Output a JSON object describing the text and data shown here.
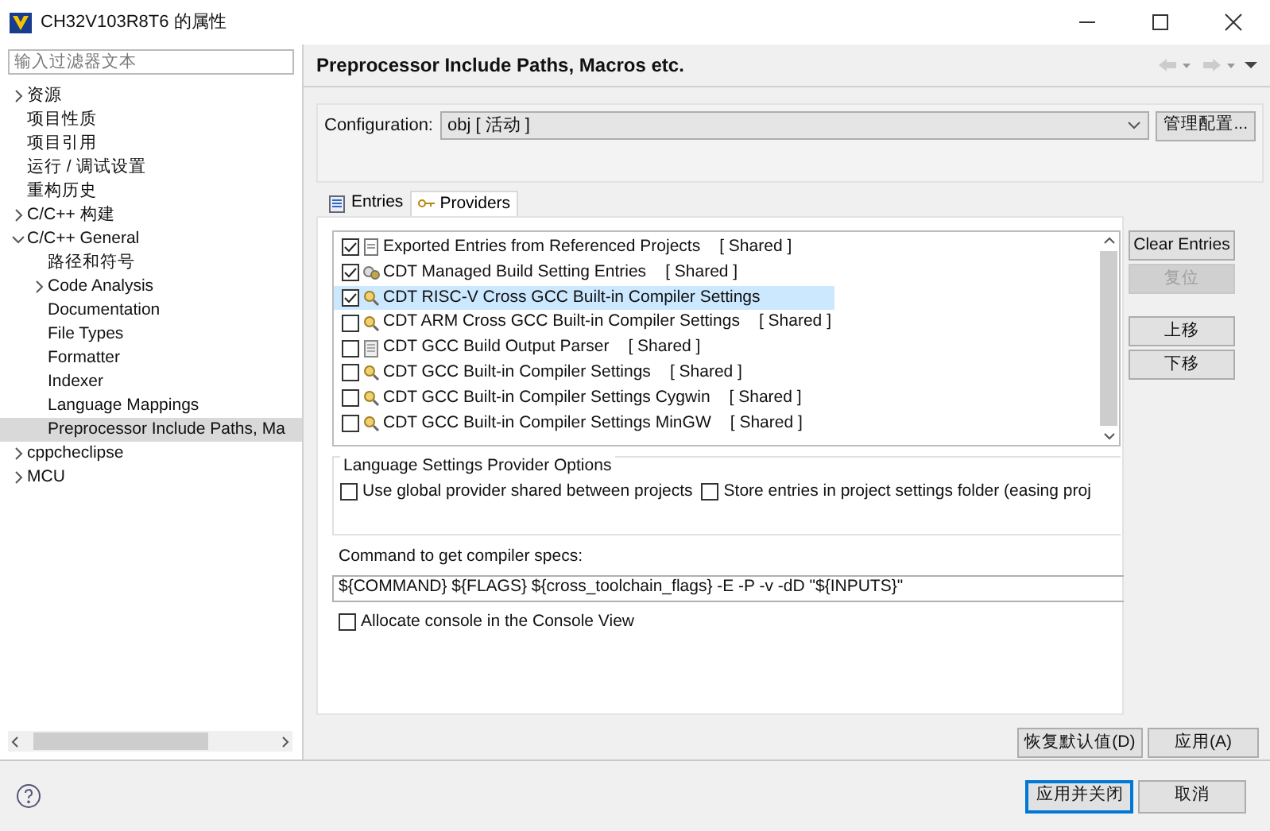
{
  "window": {
    "title": "CH32V103R8T6 的属性"
  },
  "filter": {
    "placeholder": "输入过滤器文本"
  },
  "tree": [
    {
      "label": "资源",
      "kind": "branch",
      "expanded": false,
      "selected": false
    },
    {
      "label": "项目性质",
      "kind": "leaf",
      "selected": false
    },
    {
      "label": "项目引用",
      "kind": "leaf",
      "selected": false
    },
    {
      "label": "运行 / 调试设置",
      "kind": "leaf",
      "selected": false
    },
    {
      "label": "重构历史",
      "kind": "leaf",
      "selected": false
    },
    {
      "label": "C/C++ 构建",
      "kind": "branch",
      "expanded": false,
      "selected": false
    },
    {
      "label": "C/C++ General",
      "kind": "branch",
      "expanded": true,
      "selected": false,
      "children": [
        {
          "label": "路径和符号",
          "kind": "leaf",
          "selected": false
        },
        {
          "label": "Code Analysis",
          "kind": "branch",
          "expanded": false,
          "selected": false
        },
        {
          "label": "Documentation",
          "kind": "leaf",
          "selected": false
        },
        {
          "label": "File Types",
          "kind": "leaf",
          "selected": false
        },
        {
          "label": "Formatter",
          "kind": "leaf",
          "selected": false
        },
        {
          "label": "Indexer",
          "kind": "leaf",
          "selected": false
        },
        {
          "label": "Language Mappings",
          "kind": "leaf",
          "selected": false
        },
        {
          "label": "Preprocessor Include Paths, Ma",
          "kind": "leaf",
          "selected": true
        }
      ]
    },
    {
      "label": "cppcheclipse",
      "kind": "branch",
      "expanded": false,
      "selected": false
    },
    {
      "label": "MCU",
      "kind": "branch",
      "expanded": false,
      "selected": false
    }
  ],
  "page": {
    "title": "Preprocessor Include Paths, Macros etc."
  },
  "configuration": {
    "label": "Configuration:",
    "value": "obj  [ 活动 ]",
    "manage_button": "管理配置..."
  },
  "tabs": [
    {
      "label": "Entries",
      "kind": "entries",
      "selected": false
    },
    {
      "label": "Providers",
      "kind": "providers",
      "selected": true
    }
  ],
  "providers": [
    {
      "label": "Exported Entries from Referenced Projects",
      "tag": "[ Shared ]",
      "kind": "referenced",
      "checked": true,
      "selected": false
    },
    {
      "label": "CDT Managed Build Setting Entries",
      "tag": "[ Shared ]",
      "kind": "managed",
      "checked": true,
      "selected": false
    },
    {
      "label": "CDT RISC-V Cross GCC Built-in Compiler Settings",
      "kind": "compiler",
      "checked": true,
      "selected": true
    },
    {
      "label": "CDT ARM Cross GCC Built-in Compiler Settings",
      "tag": "[ Shared ]",
      "kind": "compiler",
      "checked": false,
      "selected": false
    },
    {
      "label": "CDT GCC Build Output Parser",
      "tag": "[ Shared ]",
      "kind": "parser",
      "checked": false,
      "selected": false
    },
    {
      "label": "CDT GCC Built-in Compiler Settings",
      "tag": "[ Shared ]",
      "kind": "compiler",
      "checked": false,
      "selected": false
    },
    {
      "label": "CDT GCC Built-in Compiler Settings Cygwin",
      "tag": "[ Shared ]",
      "kind": "compiler",
      "checked": false,
      "selected": false
    },
    {
      "label": "CDT GCC Built-in Compiler Settings MinGW",
      "tag": "[ Shared ]",
      "kind": "compiler",
      "checked": false,
      "selected": false
    }
  ],
  "side_buttons": [
    {
      "label": "Clear Entries",
      "disabled": false
    },
    {
      "label": "复位",
      "disabled": true
    },
    {
      "label": "上移",
      "disabled": false
    },
    {
      "label": "下移",
      "disabled": false
    }
  ],
  "options": {
    "title": "Language Settings Provider Options",
    "checkboxes": [
      {
        "label": "Use global provider shared between projects",
        "checked": false
      },
      {
        "label": "Store entries in project settings folder (easing proj",
        "checked": false
      }
    ],
    "command_label": "Command to get compiler specs:",
    "command_value": "${COMMAND} ${FLAGS} ${cross_toolchain_flags} -E -P -v -dD \"${INPUTS}\"",
    "console": {
      "label": "Allocate console in the Console View",
      "checked": false
    }
  },
  "page_buttons": [
    {
      "label": "恢复默认值(D)"
    },
    {
      "label": "应用(A)"
    }
  ],
  "footer_buttons": [
    {
      "label": "应用并关闭",
      "default": true
    },
    {
      "label": "取消",
      "default": false
    }
  ]
}
